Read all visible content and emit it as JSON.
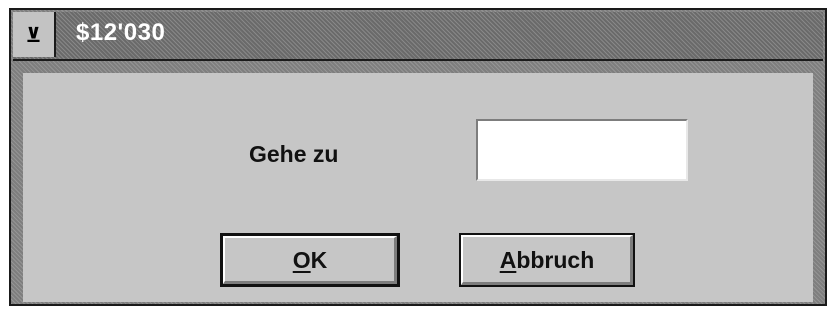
{
  "window": {
    "title": "$12'030",
    "system_menu_glyph": "⊻"
  },
  "form": {
    "goto_label": "Gehe zu",
    "goto_value": ""
  },
  "buttons": {
    "ok": {
      "mnemonic": "O",
      "rest": "K"
    },
    "cancel": {
      "mnemonic": "A",
      "rest": "bbruch"
    }
  }
}
